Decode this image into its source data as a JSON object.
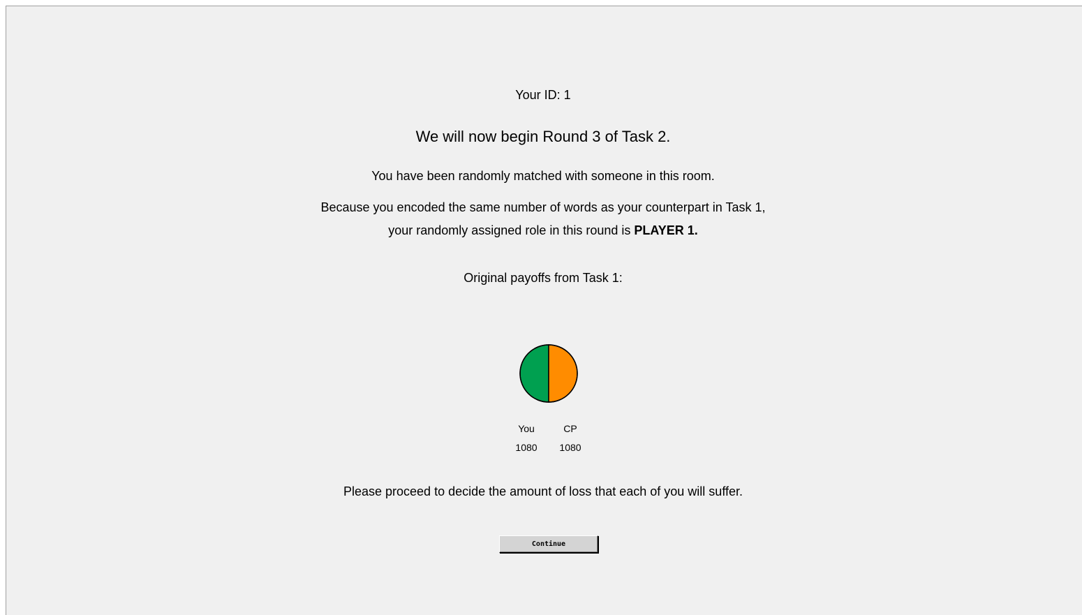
{
  "screen": {
    "your_id": "Your ID: 1",
    "round_heading": "We will now begin Round 3 of Task 2.",
    "matched_text": "You have been randomly matched with someone in this room.",
    "because_line1": "Because you encoded the same number of words as your counterpart in Task 1,",
    "because_line2_prefix": "your randomly assigned role in this round is ",
    "role": "PLAYER 1.",
    "original_payoffs_label": "Original payoffs from Task 1:",
    "proceed_text": "Please proceed to decide the amount of loss that each of you will suffer.",
    "continue_label": "Continue"
  },
  "chart_data": {
    "type": "pie",
    "categories": [
      "You",
      "CP"
    ],
    "values": [
      1080,
      1080
    ],
    "colors": [
      "#00a050",
      "#ff8c00"
    ]
  }
}
